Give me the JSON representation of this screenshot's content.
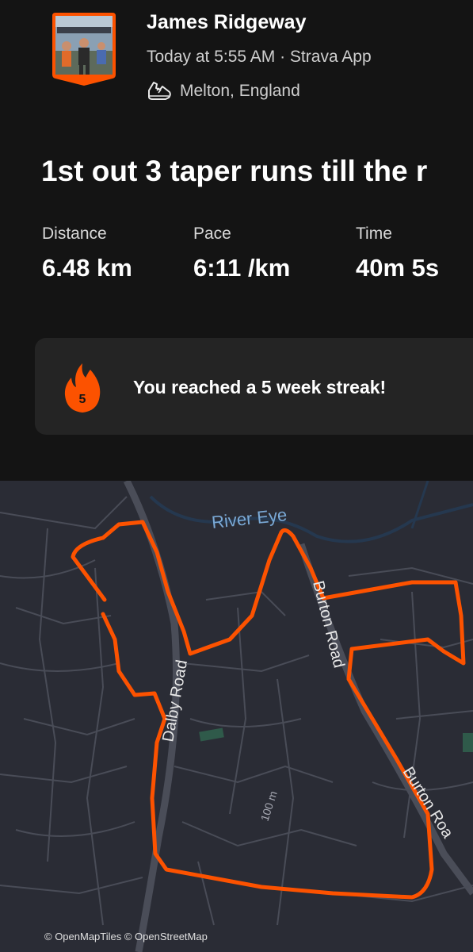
{
  "header": {
    "athlete_name": "James Ridgeway",
    "meta": "Today at 5:55 AM · Strava App",
    "location": "Melton, England",
    "avatar_icon": "runner-photo-avatar",
    "activity_icon": "running-shoe-icon"
  },
  "activity": {
    "title": "1st out 3 taper runs till the r"
  },
  "stats": [
    {
      "label": "Distance",
      "value": "6.48 km"
    },
    {
      "label": "Pace",
      "value": "6:11 /km"
    },
    {
      "label": "Time",
      "value": "40m 5s"
    }
  ],
  "streak": {
    "count": "5",
    "text": "You reached a 5 week streak!",
    "color": "#fc5200"
  },
  "map": {
    "labels": {
      "river": "River Eye",
      "dalby": "Dalby Road",
      "burton1": "Burton Road",
      "burton2": "Burton Roa",
      "scale": "100 m"
    },
    "attribution": "© OpenMapTiles © OpenStreetMap",
    "route_color": "#fc5200",
    "background": "#2a2c35"
  }
}
